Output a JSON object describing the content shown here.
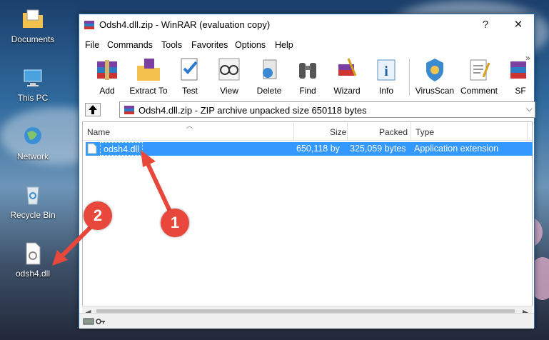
{
  "desktop": {
    "icons": [
      {
        "label": "Documents"
      },
      {
        "label": "This PC"
      },
      {
        "label": "Network"
      },
      {
        "label": "Recycle Bin"
      },
      {
        "label": "odsh4.dll"
      }
    ]
  },
  "window": {
    "title": "Odsh4.dll.zip - WinRAR (evaluation copy)",
    "help_btn": "?",
    "close_btn": "✕"
  },
  "menu": [
    "File",
    "Commands",
    "Tools",
    "Favorites",
    "Options",
    "Help"
  ],
  "toolbar": {
    "buttons": [
      "Add",
      "Extract To",
      "Test",
      "View",
      "Delete",
      "Find",
      "Wizard",
      "Info",
      "VirusScan",
      "Comment",
      "SF"
    ],
    "overflow": "»"
  },
  "address": {
    "text": "Odsh4.dll.zip - ZIP archive unpacked size 650118 bytes",
    "dropdown": "⌵"
  },
  "list": {
    "columns": [
      "Name",
      "Size",
      "Packed",
      "Type"
    ],
    "rows": [
      {
        "name": "odsh4.dll",
        "size": "650,118 by",
        "packed": "325,059 bytes",
        "type": "Application extension"
      }
    ]
  },
  "scroll": {
    "left": "◀",
    "right": "▶"
  },
  "annotations": {
    "marker_1": "1",
    "marker_2": "2"
  },
  "colors": {
    "selection": "#3399ff",
    "badge": "#e8473c"
  }
}
